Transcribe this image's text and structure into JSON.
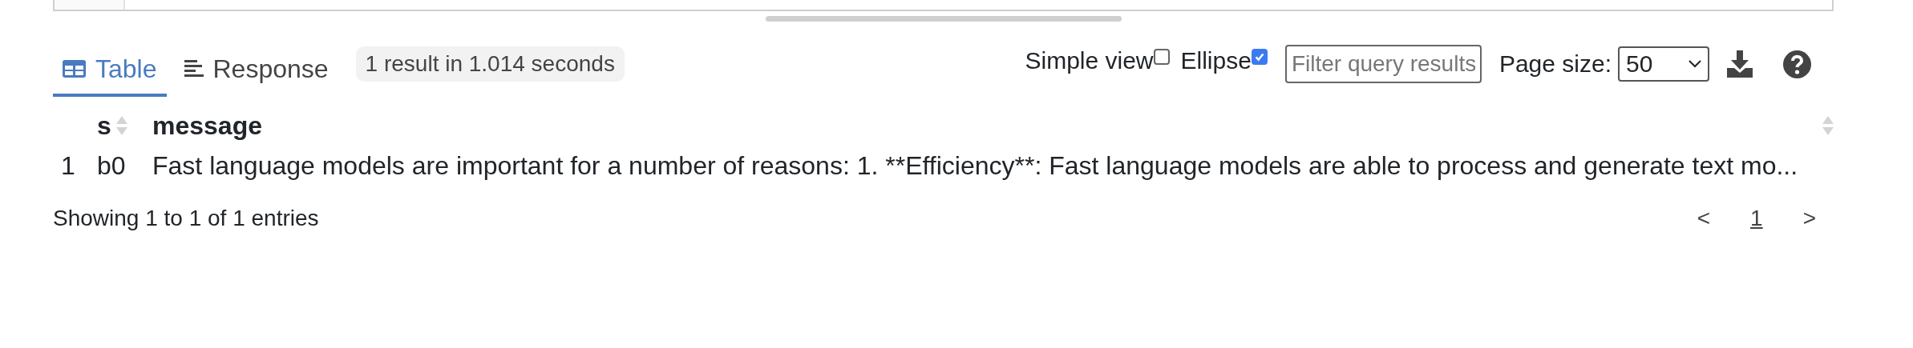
{
  "tabs": [
    {
      "label": "Table",
      "kind": "table",
      "selected": true
    },
    {
      "label": "Response",
      "kind": "response",
      "selected": false
    }
  ],
  "result_badge": "1 result in 1.014 seconds",
  "options": [
    {
      "label": "Simple view",
      "checked": false
    },
    {
      "label": "Ellipse",
      "checked": true
    }
  ],
  "filter": {
    "placeholder": "Filter query results"
  },
  "page_size": {
    "label": "Page size:",
    "value": "50"
  },
  "table": {
    "columns": [
      {
        "label": "s"
      },
      {
        "label": "message"
      }
    ],
    "rows": [
      {
        "index": "1",
        "cells": [
          "b0",
          "Fast language models are important for a number of reasons: 1. **Efficiency**: Fast language models are able to process and generate text mo..."
        ]
      }
    ]
  },
  "footer": {
    "summary": "Showing 1 to 1 of 1 entries",
    "prev": "<",
    "pages": [
      {
        "label": "1",
        "selected": true
      }
    ],
    "next": ">"
  }
}
